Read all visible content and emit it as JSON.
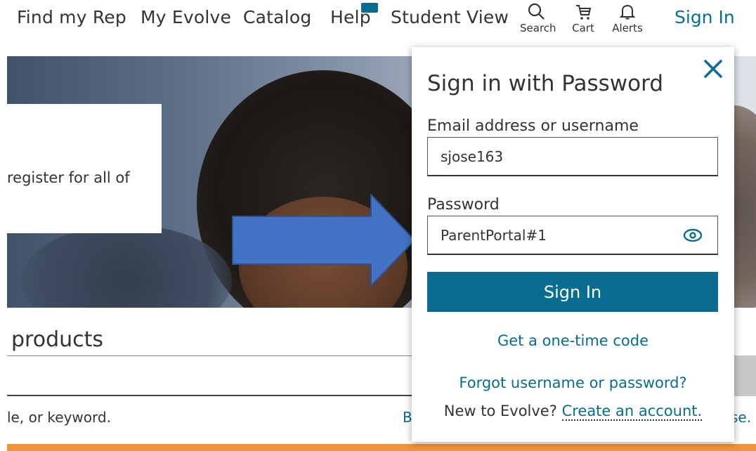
{
  "nav": {
    "links": [
      "Find my Rep",
      "My Evolve",
      "Catalog",
      "Help",
      "Student View"
    ],
    "icons": [
      {
        "label": "Search",
        "icon": "search-icon"
      },
      {
        "label": "Cart",
        "icon": "cart-icon"
      },
      {
        "label": "Alerts",
        "icon": "bell-icon"
      }
    ],
    "sign_in": "Sign In"
  },
  "hero": {
    "card_text": "register for all of"
  },
  "lower": {
    "products_heading": "products",
    "search_hint": "le, or keyword.",
    "browse_fragment": "B",
    "trailing_fragment": "se."
  },
  "signin_panel": {
    "title": "Sign in with Password",
    "email_label": "Email address or username",
    "email_value": "sjose163",
    "password_label": "Password",
    "password_value": "ParentPortal#1",
    "submit_label": "Sign In",
    "one_time_code": "Get a one-time code",
    "forgot": "Forgot username or password?",
    "new_prefix": "New to Evolve?",
    "create_account": "Create an account."
  },
  "colors": {
    "brand": "#0a6d8f",
    "arrow": "#4472c4",
    "orange_bar": "#f0953b"
  }
}
